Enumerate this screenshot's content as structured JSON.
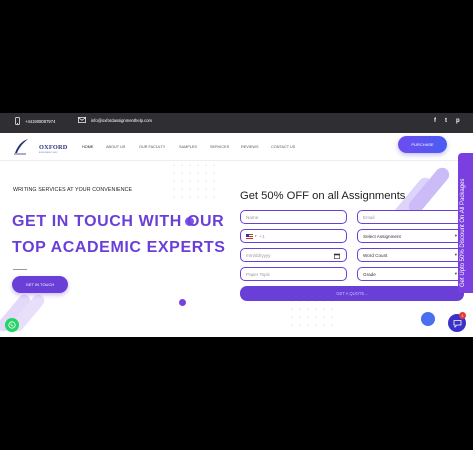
{
  "topbar": {
    "phone": "+441908087974",
    "email": "info@oxfordassignmenthelp.com",
    "social": [
      "f",
      "t",
      "p"
    ]
  },
  "nav": {
    "logo_text": "OXFORD",
    "logo_subtext": "ASSIGNMENT HELP",
    "menu": [
      "HOME",
      "ABOUT US",
      "OUR FACULTY",
      "SAMPLES",
      "SERVICES",
      "REVIEWS",
      "CONTACT US"
    ],
    "active_item": "HOME",
    "purchase_label": "PURCHASE"
  },
  "hero": {
    "kicker": "WRITING SERVICES AT YOUR CONVENIENCE",
    "line1": "GET IN TOUCH WITH OUR",
    "line2": "TOP ACADEMIC EXPERTS",
    "button_label": "GET IN TOUCH"
  },
  "form": {
    "title": "Get 50% OFF on all Assignments",
    "name_placeholder": "Name",
    "email_placeholder": "Email",
    "phone_prefix": "+1",
    "assignment_select": "Select Assignment",
    "date_placeholder": "mm/dd/yyyy",
    "word_count_select": "Word Count",
    "paper_topic_placeholder": "Paper Topic",
    "grade_select": "Grade",
    "submit_label": "GET A QUOTE..."
  },
  "side_tab": {
    "label": "Get Upto 50% Discount On All Packages"
  },
  "widgets": {
    "chat_badge_count": "1"
  },
  "colors": {
    "brand_purple": "#6a3fd8",
    "topbar_bg": "#2f2f33",
    "accent_blue": "#4a5df2",
    "whatsapp_green": "#25d366"
  }
}
